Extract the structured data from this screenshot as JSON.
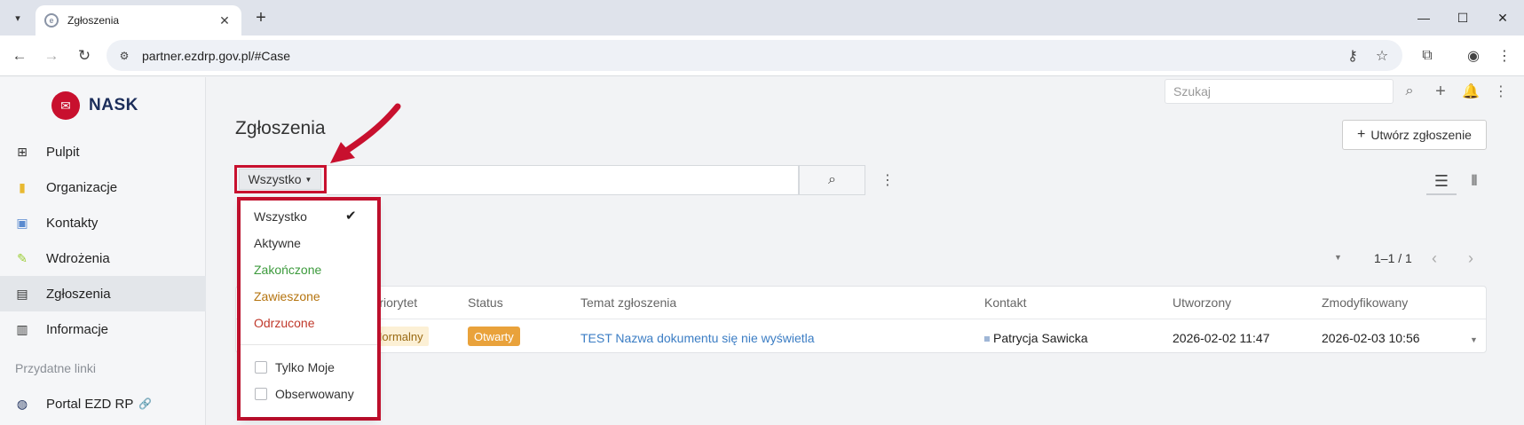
{
  "browser": {
    "tab_title": "Zgłoszenia",
    "url": "partner.ezdrp.gov.pl/#Case"
  },
  "app": {
    "logo_text": "NASK",
    "search_placeholder": "Szukaj",
    "page_title": "Zgłoszenia",
    "create_button": "Utwórz zgłoszenie"
  },
  "sidebar": {
    "items": [
      {
        "label": "Pulpit",
        "icon": "grid-icon"
      },
      {
        "label": "Organizacje",
        "icon": "building-icon"
      },
      {
        "label": "Kontakty",
        "icon": "contact-card-icon"
      },
      {
        "label": "Wdrożenia",
        "icon": "pencil-icon"
      },
      {
        "label": "Zgłoszenia",
        "icon": "briefcase-icon",
        "active": true
      },
      {
        "label": "Informacje",
        "icon": "book-icon"
      }
    ],
    "section_label": "Przydatne linki",
    "links": [
      {
        "label": "Portal EZD RP",
        "icon": "globe-icon"
      }
    ]
  },
  "filter": {
    "selected": "Wszystko",
    "options": [
      {
        "label": "Wszystko",
        "color": "#333333",
        "checked": true
      },
      {
        "label": "Aktywne",
        "color": "#333333"
      },
      {
        "label": "Zakończone",
        "color": "#3c9a3c"
      },
      {
        "label": "Zawieszone",
        "color": "#b5740f"
      },
      {
        "label": "Odrzucone",
        "color": "#c0392b"
      }
    ],
    "checkboxes": [
      {
        "label": "Tylko Moje",
        "checked": false
      },
      {
        "label": "Obserwowany",
        "checked": false
      }
    ]
  },
  "pagination": {
    "text": "1–1 / 1"
  },
  "table": {
    "columns": [
      "Priorytet",
      "Status",
      "Temat zgłoszenia",
      "Kontakt",
      "Utworzony",
      "Zmodyfikowany"
    ],
    "rows": [
      {
        "priority": "Normalny",
        "status": "Otwarty",
        "subject": "TEST Nazwa dokumentu się nie wyświetla",
        "contact": "Patrycja Sawicka",
        "created": "2026-02-02 11:47",
        "modified": "2026-02-03 10:56"
      }
    ]
  },
  "colors": {
    "accent_red": "#c8102e",
    "status_open": "#e9a23b",
    "link_blue": "#3b7dc4"
  }
}
